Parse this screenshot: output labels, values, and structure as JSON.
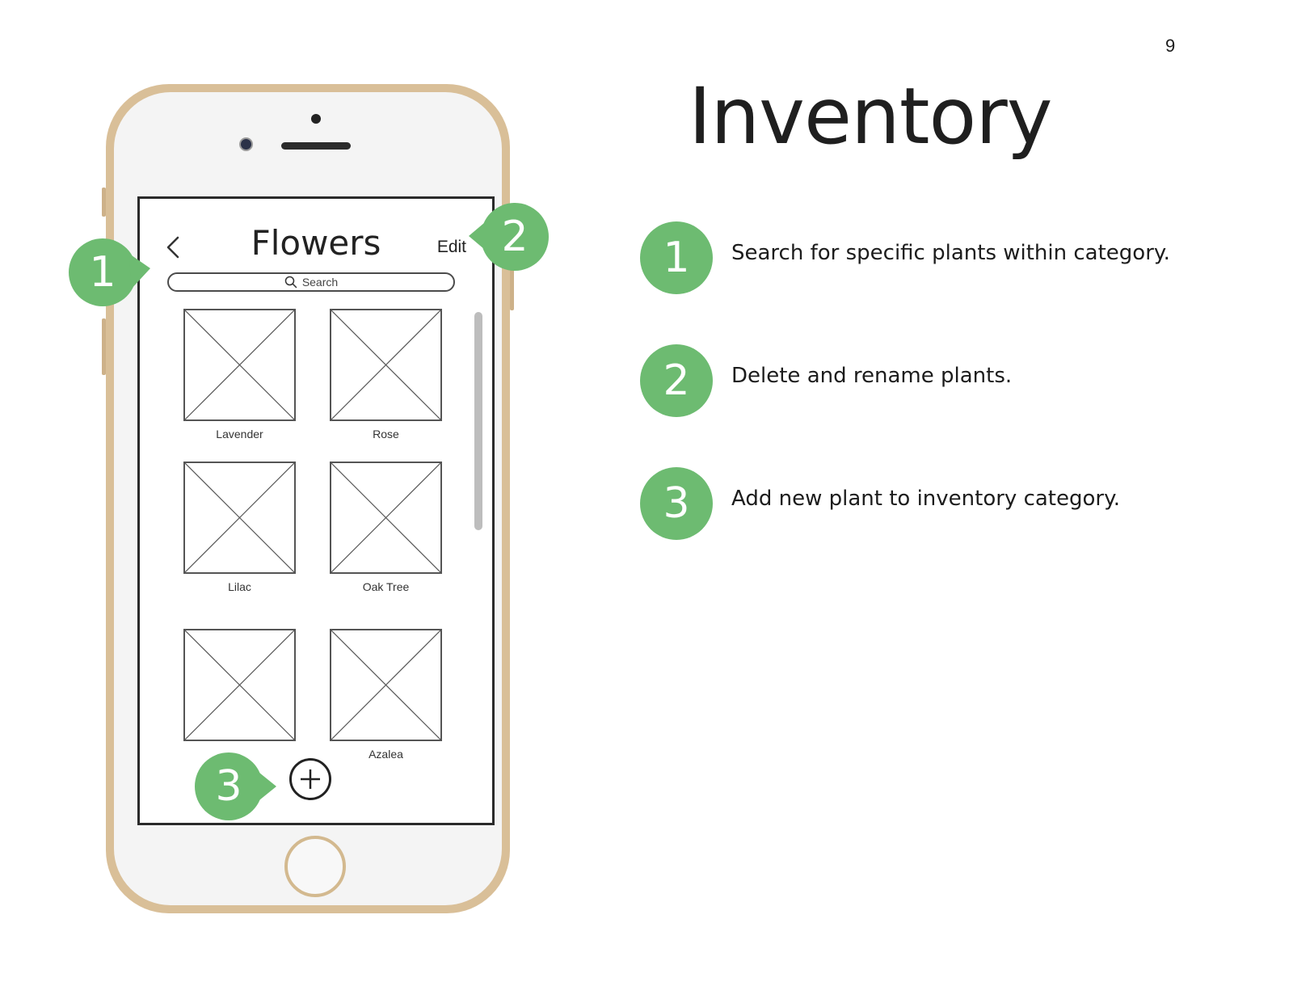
{
  "page": {
    "number": "9",
    "title": "Inventory"
  },
  "colors": {
    "marker_green": "#6dbb71",
    "phone_gold": "#d9bf98"
  },
  "screen": {
    "title": "Flowers",
    "back_icon": "chevron-left-icon",
    "edit_label": "Edit",
    "search_placeholder": "Search",
    "tiles": [
      {
        "label": "Lavender"
      },
      {
        "label": "Rose"
      },
      {
        "label": "Lilac"
      },
      {
        "label": "Oak Tree"
      },
      {
        "label": ""
      },
      {
        "label": "Azalea"
      }
    ],
    "add_icon": "plus-circle-icon"
  },
  "markers": {
    "search": "1",
    "edit": "2",
    "add": "3"
  },
  "legend": [
    {
      "number": "1",
      "text": "Search for specific plants within category."
    },
    {
      "number": "2",
      "text": "Delete and rename plants."
    },
    {
      "number": "3",
      "text": "Add new plant to inventory category."
    }
  ]
}
